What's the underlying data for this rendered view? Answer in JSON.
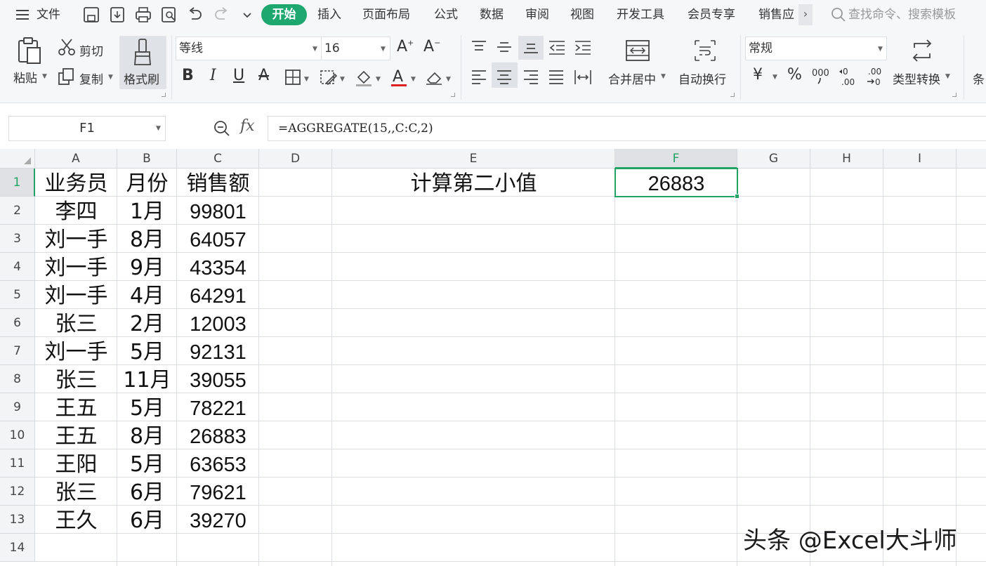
{
  "menubar": {
    "file_label": "文件",
    "tabs": [
      "开始",
      "插入",
      "页面布局",
      "公式",
      "数据",
      "审阅",
      "视图",
      "开发工具",
      "会员专享",
      "销售应"
    ],
    "more": "›",
    "search_placeholder": "查找命令、搜索模板",
    "active_color": "#1ea76e"
  },
  "ribbon": {
    "clipboard": {
      "paste": "粘贴",
      "cut": "剪切",
      "copy": "复制",
      "format_painter": "格式刷"
    },
    "font": {
      "name": "等线",
      "size": "16"
    },
    "alignment": {
      "merge_center": "合并居中",
      "wrap_text": "自动换行"
    },
    "number": {
      "format": "常规",
      "type_convert": "类型转换",
      "truncated": "条"
    }
  },
  "formula_bar": {
    "name_box": "F1",
    "fx": "fx",
    "formula": "=AGGREGATE(15,,C:C,2)"
  },
  "sheet": {
    "columns": [
      "A",
      "B",
      "C",
      "D",
      "E",
      "F",
      "G",
      "H",
      "I"
    ],
    "rows": [
      "1",
      "2",
      "3",
      "4",
      "5",
      "6",
      "7",
      "8",
      "9",
      "10",
      "11",
      "12",
      "13",
      "14"
    ],
    "header": [
      "业务员",
      "月份",
      "销售额"
    ],
    "data": [
      [
        "李四",
        "1月",
        "99801"
      ],
      [
        "刘一手",
        "8月",
        "64057"
      ],
      [
        "刘一手",
        "9月",
        "43354"
      ],
      [
        "刘一手",
        "4月",
        "64291"
      ],
      [
        "张三",
        "2月",
        "12003"
      ],
      [
        "刘一手",
        "5月",
        "92131"
      ],
      [
        "张三",
        "11月",
        "39055"
      ],
      [
        "王五",
        "5月",
        "78221"
      ],
      [
        "王五",
        "8月",
        "26883"
      ],
      [
        "王阳",
        "5月",
        "63653"
      ],
      [
        "张三",
        "6月",
        "79621"
      ],
      [
        "王久",
        "6月",
        "39270"
      ]
    ],
    "e1_label": "计算第二小值",
    "f1_value": "26883",
    "selection_color": "#21a366"
  },
  "watermark": "头条 @Excel大斗师"
}
